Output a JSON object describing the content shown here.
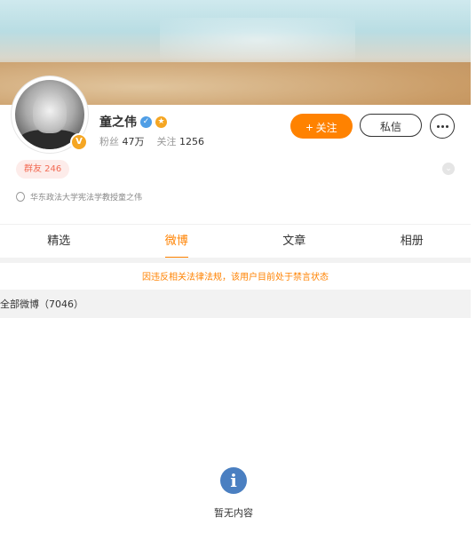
{
  "profile": {
    "name": "童之伟",
    "fans_label": "粉丝",
    "fans_value": "47万",
    "follow_label": "关注",
    "follow_value": "1256",
    "verified_badge": "V",
    "weibo_icon": "weibo-verified-icon",
    "fan_icon": "fan-badge-icon",
    "group_chip": "群友 246",
    "bio": "华东政法大学宪法学教授童之伟"
  },
  "actions": {
    "follow_label": "关注",
    "follow_prefix": "+",
    "message_label": "私信"
  },
  "tabs": [
    {
      "label": "精选"
    },
    {
      "label": "微博"
    },
    {
      "label": "文章"
    },
    {
      "label": "相册"
    }
  ],
  "active_tab": "微博",
  "notice": "因违反相关法律法规，该用户目前处于禁言状态",
  "all_weibo_label": "全部微博（7046）",
  "empty": {
    "icon_char": "i",
    "text": "暂无内容"
  },
  "colors": {
    "accent": "#ff8200",
    "chip_bg": "#fdecea",
    "chip_text": "#f26b54",
    "info_icon": "#4a7fc1"
  }
}
